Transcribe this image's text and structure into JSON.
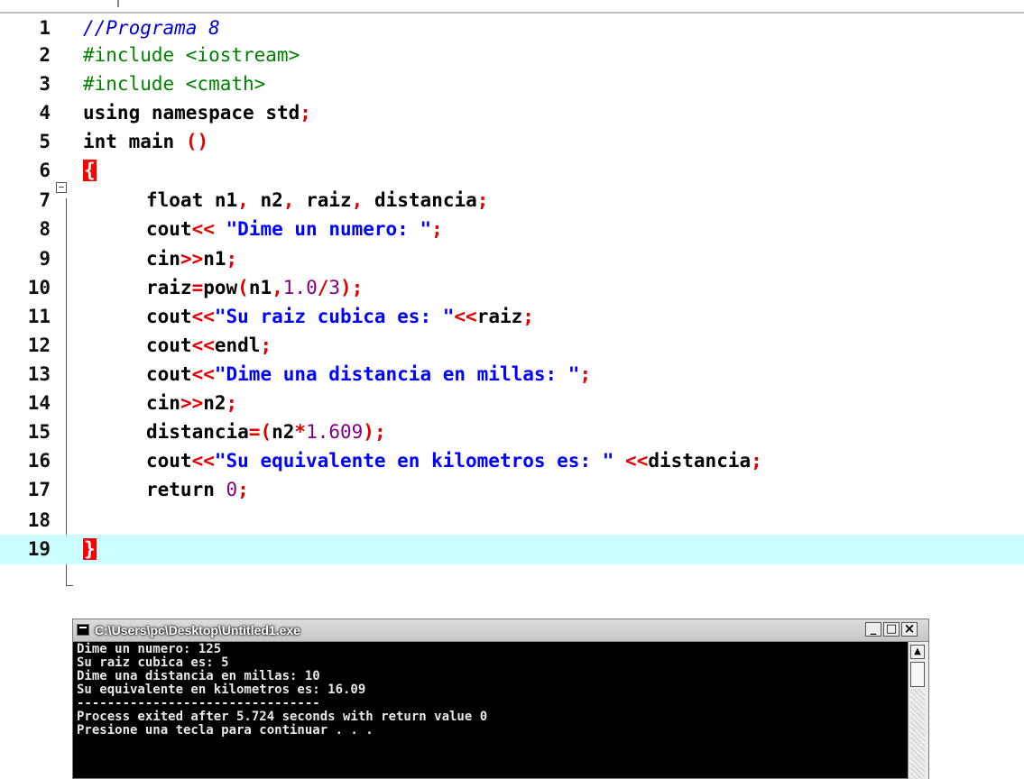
{
  "editor": {
    "lines": [
      {
        "n": "1",
        "t": "//Programa 8"
      },
      {
        "n": "2",
        "t": "#include <iostream>"
      },
      {
        "n": "3",
        "t": "#include <cmath>"
      },
      {
        "n": "4",
        "t": "using namespace std;"
      },
      {
        "n": "5",
        "t": "int main ()"
      },
      {
        "n": "6",
        "t": "{"
      },
      {
        "n": "7",
        "t": "float n1, n2, raiz, distancia;"
      },
      {
        "n": "8",
        "t": "cout<< \"Dime un numero: \";"
      },
      {
        "n": "9",
        "t": "cin>>n1;"
      },
      {
        "n": "10",
        "t": "raiz=pow(n1,1.0/3);"
      },
      {
        "n": "11",
        "t": "cout<<\"Su raiz cubica es: \"<<raiz;"
      },
      {
        "n": "12",
        "t": "cout<<endl;"
      },
      {
        "n": "13",
        "t": "cout<<\"Dime una distancia en millas: \";"
      },
      {
        "n": "14",
        "t": "cin>>n2;"
      },
      {
        "n": "15",
        "t": "distancia=(n2*1.609);"
      },
      {
        "n": "16",
        "t": "cout<<\"Su equivalente en kilometros es: \" <<distancia;"
      },
      {
        "n": "17",
        "t": "return 0;"
      },
      {
        "n": "18",
        "t": ""
      },
      {
        "n": "19",
        "t": "}"
      }
    ]
  },
  "console": {
    "title": "C:\\Users\\pc\\Desktop\\Untitled1.exe",
    "minimize": "_",
    "maximize": "□",
    "close": "×",
    "output": [
      "Dime un numero: 125",
      "Su raiz cubica es: 5",
      "Dime una distancia en millas: 10",
      "Su equivalente en kilometros es: 16.09",
      "--------------------------------",
      "Process exited after 5.724 seconds with return value 0",
      "Presione una tecla para continuar . . ."
    ]
  }
}
